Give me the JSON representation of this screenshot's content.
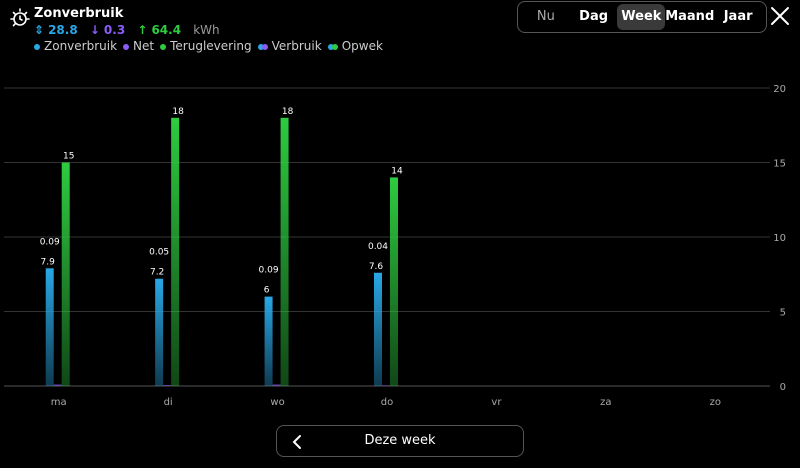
{
  "header": {
    "title": "Zonverbruik",
    "stats": {
      "total": "28.8",
      "import": "0.3",
      "export": "64.4",
      "unit": "kWh"
    },
    "legend": [
      {
        "label": "Zonverbruik",
        "color": "#29a8e6",
        "kind": "dot"
      },
      {
        "label": "Net",
        "color": "#8b5cf6",
        "kind": "dot"
      },
      {
        "label": "Teruglevering",
        "color": "#2ecc40",
        "kind": "dot"
      },
      {
        "label": "Verbruik",
        "colors": [
          "#29a8e6",
          "#8b5cf6"
        ],
        "kind": "double"
      },
      {
        "label": "Opwek",
        "colors": [
          "#29a8e6",
          "#2ecc40"
        ],
        "kind": "double"
      }
    ]
  },
  "tabs": [
    {
      "label": "Nu",
      "state": "muted"
    },
    {
      "label": "Dag",
      "state": "normal"
    },
    {
      "label": "Week",
      "state": "active"
    },
    {
      "label": "Maand",
      "state": "normal"
    },
    {
      "label": "Jaar",
      "state": "normal"
    }
  ],
  "nav": {
    "label": "Deze week"
  },
  "chart_data": {
    "type": "bar",
    "categories": [
      "ma",
      "di",
      "wo",
      "do",
      "vr",
      "za",
      "zo"
    ],
    "series": [
      {
        "name": "Zonverbruik",
        "color": "#29a8e6",
        "values": [
          7.9,
          7.2,
          6,
          7.6,
          null,
          null,
          null
        ],
        "labels": [
          "7.9",
          "7.2",
          "6",
          "7.6"
        ]
      },
      {
        "name": "Net",
        "color": "#8b5cf6",
        "values": [
          0.09,
          0.05,
          0.09,
          0.04,
          null,
          null,
          null
        ],
        "labels": [
          "0.09",
          "0.05",
          "0.09",
          "0.04"
        ]
      },
      {
        "name": "Teruglevering",
        "color": "#2ecc40",
        "values": [
          15,
          18,
          18,
          14,
          null,
          null,
          null
        ],
        "labels": [
          "15",
          "18",
          "18",
          "14"
        ]
      }
    ],
    "y_ticks": [
      "0",
      "5",
      "10",
      "15",
      "20"
    ],
    "ylim": [
      0,
      20
    ],
    "grid": true
  }
}
